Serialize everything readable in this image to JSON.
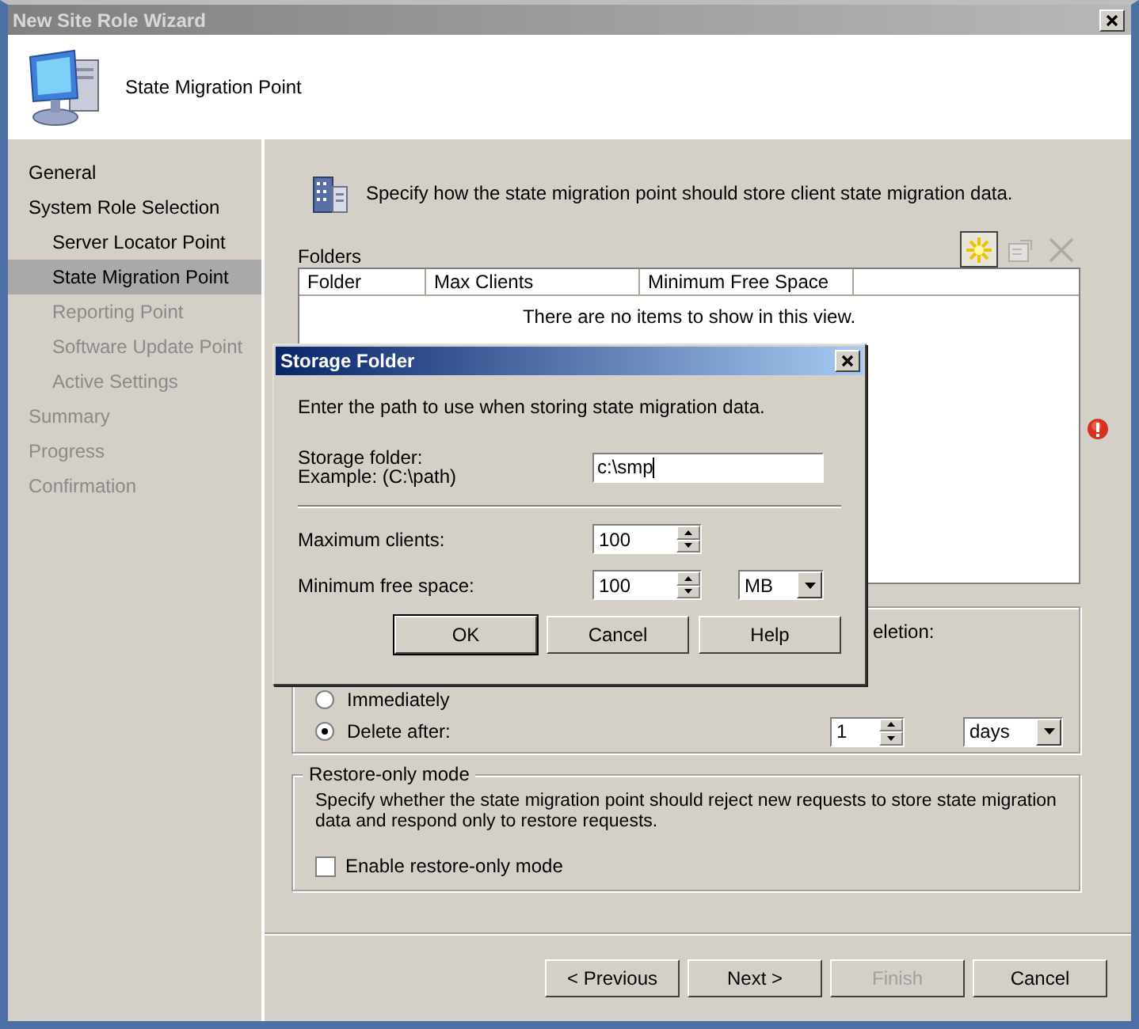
{
  "window": {
    "title": "New Site Role Wizard"
  },
  "header": {
    "title": "State Migration Point"
  },
  "nav": {
    "items": [
      {
        "label": "General",
        "selected": false,
        "disabled": false
      },
      {
        "label": "System Role Selection",
        "selected": false,
        "disabled": false,
        "children": [
          {
            "label": "Server Locator Point",
            "selected": false,
            "disabled": false
          },
          {
            "label": "State Migration Point",
            "selected": true,
            "disabled": false
          },
          {
            "label": "Reporting Point",
            "selected": false,
            "disabled": true
          },
          {
            "label": "Software Update Point",
            "selected": false,
            "disabled": true
          },
          {
            "label": "Active Settings",
            "selected": false,
            "disabled": true
          }
        ]
      },
      {
        "label": "Summary",
        "selected": false,
        "disabled": true
      },
      {
        "label": "Progress",
        "selected": false,
        "disabled": true
      },
      {
        "label": "Confirmation",
        "selected": false,
        "disabled": true
      }
    ]
  },
  "intro": "Specify how the state migration point should store client state migration data.",
  "folders": {
    "label": "Folders",
    "toolbar": [
      {
        "kind": "new",
        "disabled": false
      },
      {
        "kind": "properties",
        "disabled": true
      },
      {
        "kind": "delete",
        "disabled": true
      }
    ],
    "columns": [
      "Folder",
      "Max Clients",
      "Minimum Free Space"
    ],
    "empty_text": "There are no items to show in this view."
  },
  "deletion": {
    "label_fragment": "eletion:",
    "options": [
      {
        "label": "Immediately",
        "selected": false
      },
      {
        "label": "Delete after:",
        "selected": true
      }
    ],
    "value": "1",
    "unit": "days"
  },
  "restore_only": {
    "title": "Restore-only mode",
    "description": "Specify whether the state migration point should reject new requests to store state migration data and respond only to restore requests.",
    "checkbox": {
      "label": "Enable restore-only mode",
      "checked": false
    }
  },
  "buttons": [
    {
      "label": "< Previous",
      "disabled": false
    },
    {
      "label": "Next >",
      "disabled": false
    },
    {
      "label": "Finish",
      "disabled": true
    },
    {
      "label": "Cancel",
      "disabled": false
    }
  ],
  "dialog": {
    "title": "Storage Folder",
    "instructions": "Enter the path to use when storing state migration data.",
    "folder_label": "Storage folder:",
    "folder_example": "Example: (C:\\path)",
    "folder_value": "c:\\smp",
    "fields": [
      {
        "label": "Maximum clients:",
        "value": "100"
      },
      {
        "label": "Minimum free space:",
        "value": "100",
        "unit": "MB"
      }
    ],
    "buttons": [
      "OK",
      "Cancel",
      "Help"
    ]
  }
}
